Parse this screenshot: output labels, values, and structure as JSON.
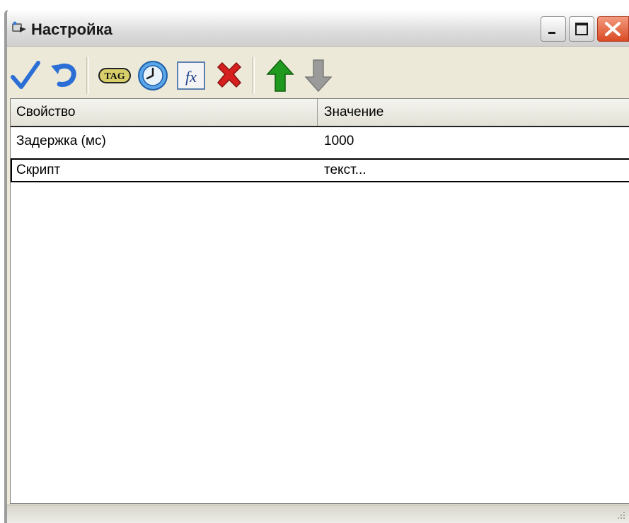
{
  "window": {
    "title": "Настройка"
  },
  "toolbar": {
    "buttons": [
      {
        "name": "apply",
        "icon": "checkmark-icon"
      },
      {
        "name": "undo",
        "icon": "undo-icon"
      },
      {
        "name": "tag",
        "icon": "tag-icon",
        "label": "TAG"
      },
      {
        "name": "timer",
        "icon": "clock-icon"
      },
      {
        "name": "function",
        "icon": "function-icon",
        "label": "fx"
      },
      {
        "name": "delete",
        "icon": "delete-icon"
      },
      {
        "name": "move-up",
        "icon": "arrow-up-icon"
      },
      {
        "name": "move-down",
        "icon": "arrow-down-icon",
        "disabled": true
      }
    ]
  },
  "grid": {
    "columns": [
      "Свойство",
      "Значение"
    ],
    "rows": [
      {
        "property": "Задержка (мс)",
        "value": "1000"
      },
      {
        "property": "Скрипт",
        "value": "текст...",
        "selected": true
      }
    ]
  },
  "colors": {
    "accent_check": "#2b6fd6",
    "accent_up": "#1f9a1f",
    "accent_delete": "#d61f1f",
    "close_button": "#d94a23"
  }
}
